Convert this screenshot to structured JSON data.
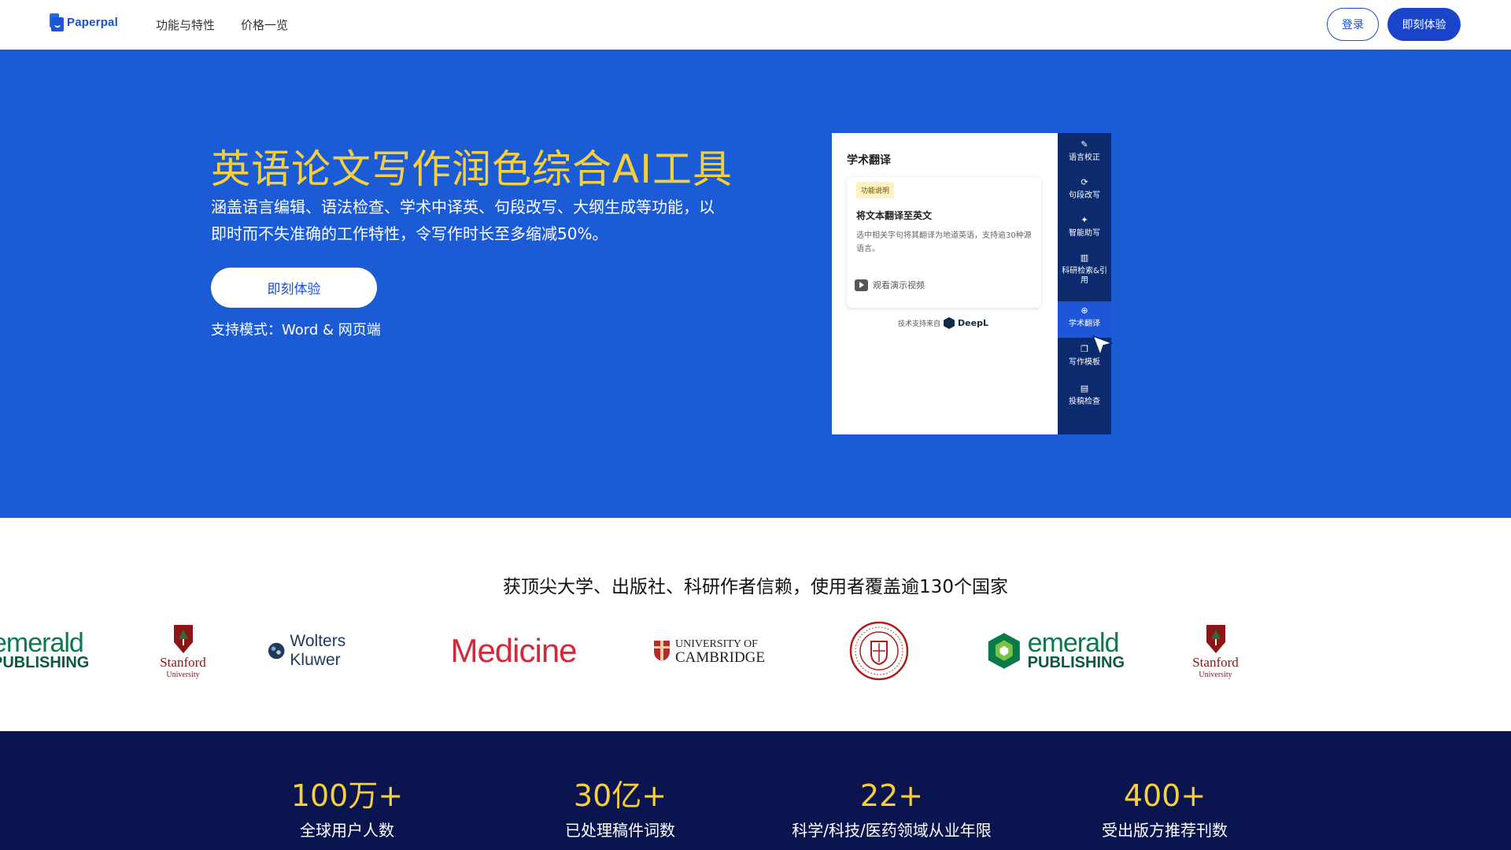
{
  "nav": {
    "logo_text": "Paperpal",
    "links": [
      "功能与特性",
      "价格一览"
    ],
    "login_label": "登录",
    "try_label": "即刻体验"
  },
  "hero": {
    "title": "英语论文写作润色综合AI工具",
    "description": "涵盖语言编辑、语法检查、学术中译英、句段改写、大纲生成等功能，以即时而不失准确的工作特性，令写作时长至多缩减50%。",
    "cta_label": "即刻体验",
    "modes": "支持模式：Word & 网页端",
    "colors": {
      "background": "#1b5bd6",
      "title": "#f6cf3c"
    }
  },
  "mock": {
    "title": "学术翻译",
    "badge": "功能说明",
    "heading": "将文本翻译至英文",
    "paragraph": "选中相关字句将其翻译为地道英语，支持逾30种源语言。",
    "video_label": "观看演示视频",
    "powered_by": "技术支持来自",
    "deepl": "DeepL",
    "side_items": [
      {
        "label": "语言校正",
        "icon": "pen-icon"
      },
      {
        "label": "句段改写",
        "icon": "refresh-icon"
      },
      {
        "label": "智能助写",
        "icon": "sparkle-icon"
      },
      {
        "label": "科研检索&引用",
        "icon": "books-icon"
      },
      {
        "label": "学术翻译",
        "icon": "globe-icon",
        "active": true
      },
      {
        "label": "写作模板",
        "icon": "copy-icon"
      },
      {
        "label": "投稿检查",
        "icon": "document-icon"
      }
    ]
  },
  "trust": {
    "title": "获顶尖大学、出版社、科研作者信赖，使用者覆盖逾130个国家",
    "logos": {
      "emerald_top": "emerald",
      "emerald_bottom": "PUBLISHING",
      "stanford": "Stanford",
      "stanford_sub": "University",
      "wolters": "Wolters Kluwer",
      "medicine": "Medicine",
      "cambridge_1": "UNIVERSITY OF",
      "cambridge_2": "CAMBRIDGE"
    }
  },
  "stats": [
    {
      "number": "100万+",
      "label": "全球用户人数"
    },
    {
      "number": "30亿+",
      "label": "已处理稿件词数"
    },
    {
      "number": "22+",
      "label": "科学/科技/医药领域从业年限"
    },
    {
      "number": "400+",
      "label": "受出版方推荐刊数"
    }
  ]
}
